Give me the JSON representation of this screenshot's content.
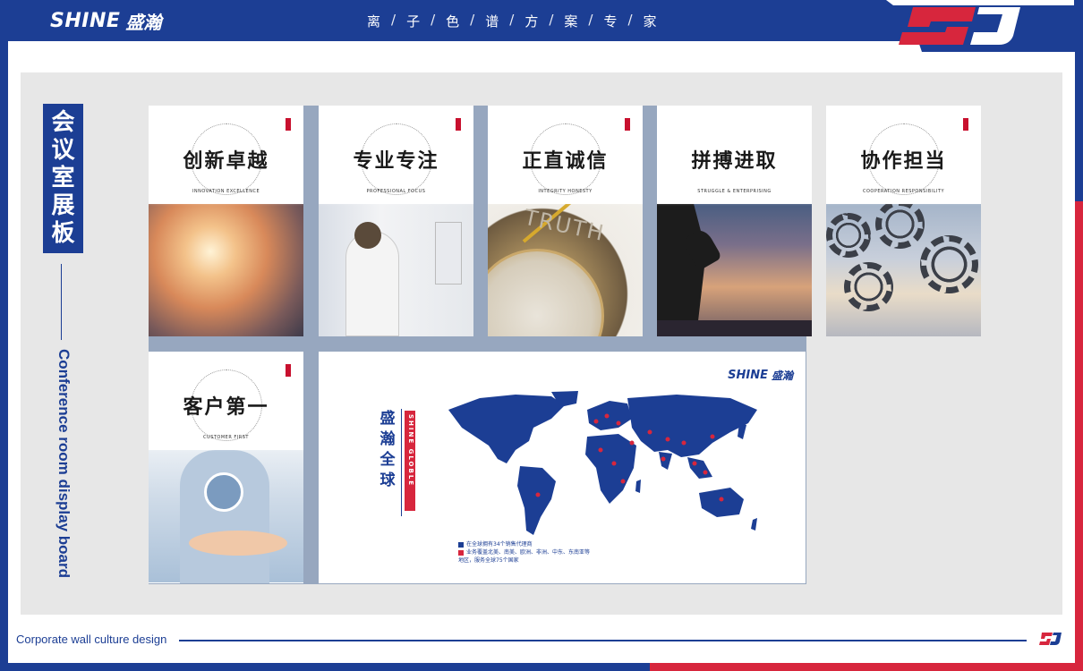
{
  "header": {
    "brand_en": "SHINE",
    "brand_cn": "盛瀚",
    "slogan_chars": [
      "离",
      "子",
      "色",
      "谱",
      "方",
      "案",
      "专",
      "家"
    ],
    "slogan_sep": "/"
  },
  "sidebar": {
    "title_cn_chars": [
      "会",
      "议",
      "室",
      "展",
      "板"
    ],
    "title_en": "Conference room display board"
  },
  "panels": [
    {
      "title": "创新卓越",
      "subtitle": "INNOVATION EXCELLENCE"
    },
    {
      "title": "专业专注",
      "subtitle": "PROFESSIONAL FOCUS"
    },
    {
      "title": "正直诚信",
      "subtitle": "INTEGRITY HONESTY",
      "photo_text": "TRUTH"
    },
    {
      "title": "拼搏进取",
      "subtitle": "STRUGGLE & ENTERPRISING"
    },
    {
      "title": "协作担当",
      "subtitle": "COOPERATION RESPONSIBILITY"
    },
    {
      "title": "客户第一",
      "subtitle": "CUSTOMER FIRST"
    }
  ],
  "map_panel": {
    "brand_en": "SHINE",
    "brand_cn": "盛瀚",
    "title_chars": [
      "盛",
      "瀚",
      "全",
      "球"
    ],
    "title_en": "SHINE GLOBLE",
    "note_line1": "在全球拥有34个销售代理商",
    "note_line2": "业务覆盖北美、南美、欧洲、非洲、中东、东南亚等",
    "note_line3": "地区，服务全球75个国家"
  },
  "footer": {
    "text": "Corporate wall culture design"
  },
  "colors": {
    "brand_blue": "#1c3e94",
    "brand_red": "#d7263d",
    "board_gray": "#e7e7e7",
    "panel_gap": "#97a7bf"
  }
}
